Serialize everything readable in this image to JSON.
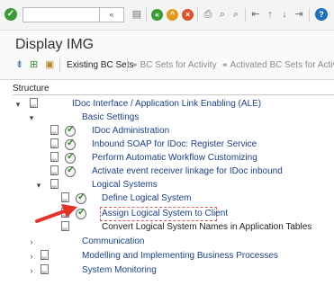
{
  "toolbar": {
    "ok_glyph": "✓",
    "command_value": "",
    "dropdown_glyph": "«",
    "help_glyph": "?",
    "icons": [
      "save-icon",
      "back-icon",
      "exit-icon",
      "cancel-icon",
      "print-icon",
      "find-icon",
      "find-next-icon",
      "first-page-icon",
      "previous-page-icon",
      "next-page-icon",
      "last-page-icon",
      "help-icon"
    ]
  },
  "page": {
    "title": "Display IMG"
  },
  "app_toolbar": {
    "existing_bc_sets": "Existing BC Sets",
    "bc_sets_for_activity": "BC Sets for Activity",
    "activated_bc_sets": "Activated BC Sets for Activity"
  },
  "tree": {
    "header": "Structure",
    "nodes": [
      {
        "label": "IDoc Interface / Application Link Enabling (ALE)",
        "expander": "▾"
      },
      {
        "label": "Basic Settings",
        "expander": "▾"
      },
      {
        "label": "IDoc Administration"
      },
      {
        "label": "Inbound SOAP for IDoc: Register Service"
      },
      {
        "label": "Perform Automatic Workflow Customizing"
      },
      {
        "label": "Activate event receiver linkage for IDoc inbound"
      },
      {
        "label": "Logical Systems",
        "expander": "▾"
      },
      {
        "label": "Define Logical System"
      },
      {
        "label": "Assign Logical System to Client"
      },
      {
        "label": "Convert Logical System Names in Application Tables"
      },
      {
        "label": "Communication",
        "expander": "›"
      },
      {
        "label": "Modelling and Implementing Business Processes",
        "expander": "›"
      },
      {
        "label": "System Monitoring",
        "expander": "›"
      }
    ]
  },
  "colors": {
    "link": "#1a3f8a",
    "activity_check": "#2f8a2b",
    "arrow": "#e8302a",
    "help": "#1f6fbf"
  }
}
